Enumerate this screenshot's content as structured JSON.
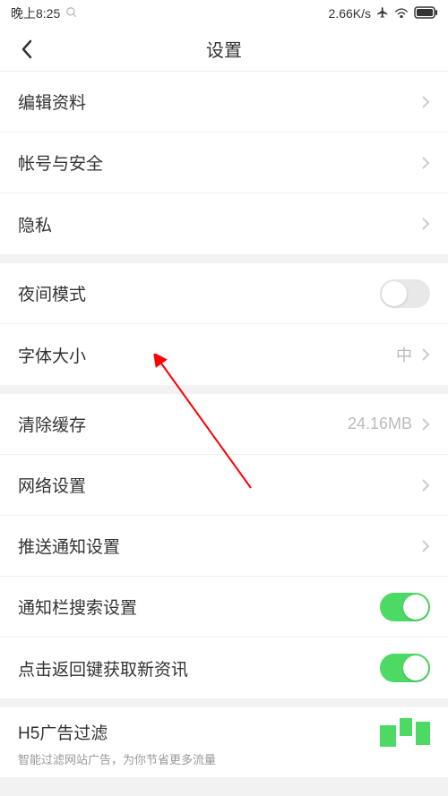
{
  "status_bar": {
    "time": "晚上8:25",
    "speed": "2.66K/s"
  },
  "header": {
    "title": "设置"
  },
  "sections": [
    {
      "rows": [
        {
          "label": "编辑资料",
          "type": "nav"
        },
        {
          "label": "帐号与安全",
          "type": "nav"
        },
        {
          "label": "隐私",
          "type": "nav"
        }
      ]
    },
    {
      "rows": [
        {
          "label": "夜间模式",
          "type": "toggle",
          "on": false
        },
        {
          "label": "字体大小",
          "type": "nav",
          "value": "中"
        }
      ]
    },
    {
      "rows": [
        {
          "label": "清除缓存",
          "type": "nav",
          "value": "24.16MB"
        },
        {
          "label": "网络设置",
          "type": "nav"
        },
        {
          "label": "推送通知设置",
          "type": "nav"
        },
        {
          "label": "通知栏搜索设置",
          "type": "toggle",
          "on": true
        },
        {
          "label": "点击返回键获取新资讯",
          "type": "toggle",
          "on": true
        }
      ]
    },
    {
      "rows": [
        {
          "label": "H5广告过滤",
          "type": "toggle-censored",
          "sub": "智能过滤网站广告，为你节省更多流量"
        }
      ]
    }
  ]
}
